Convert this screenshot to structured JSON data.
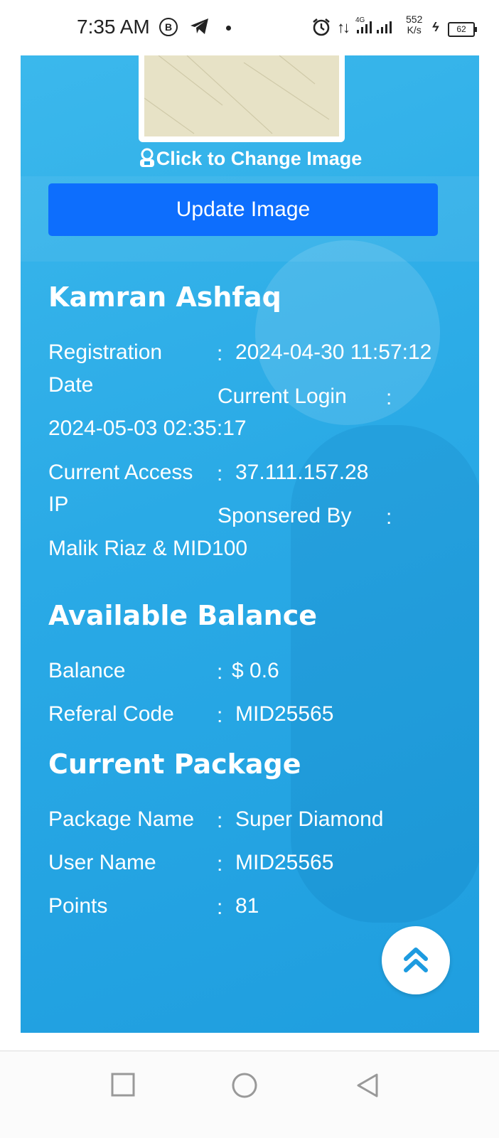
{
  "status_bar": {
    "time": "7:35 AM",
    "b_badge": "B",
    "network": "4G",
    "speed_value": "552",
    "speed_unit": "K/s",
    "battery": "62"
  },
  "profile_image": {
    "change_label": "Click to Change Image",
    "update_button": "Update Image"
  },
  "user": {
    "name": "Kamran Ashfaq",
    "registration_label_1": "Registration",
    "registration_label_2": "Date",
    "registration_value": "2024-04-30 11:57:12",
    "current_login_label": "Current Login",
    "current_login_value": "2024-05-03 02:35:17",
    "access_ip_label_1": "Current Access",
    "access_ip_label_2": "IP",
    "access_ip_value": "37.111.157.28",
    "sponsored_label": "Sponsered By",
    "sponsored_value": "Malik Riaz & MID100"
  },
  "balance_section": {
    "title": "Available Balance",
    "balance_label": "Balance",
    "balance_value": "$ 0.6",
    "referral_label": "Referal Code",
    "referral_value": "MID25565"
  },
  "package_section": {
    "title": "Current Package",
    "package_name_label": "Package Name",
    "package_name_value": "Super Diamond",
    "username_label": "User Name",
    "username_value": "MID25565",
    "points_label": "Points",
    "points_value": "81"
  },
  "colon": ":",
  "icons": {
    "scroll_top": "double-chevron-up-icon",
    "change_image": "user-icon"
  },
  "colors": {
    "card_bg": "#2aaae6",
    "button": "#0d6efd",
    "fab_arrow": "#1d9be0"
  }
}
